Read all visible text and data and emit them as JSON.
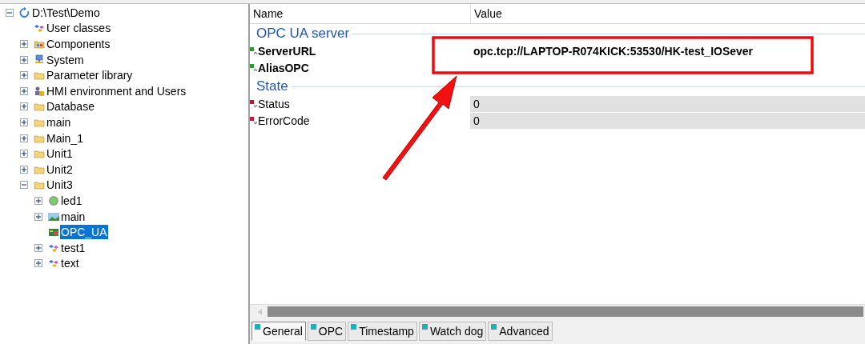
{
  "tree": [
    {
      "label": "D:\\Test\\Demo",
      "kind": "project",
      "expanded": true,
      "selected": false,
      "children": [
        {
          "label": "User classes",
          "kind": "classes",
          "selected": false
        },
        {
          "label": "Components",
          "kind": "components",
          "expanded": false,
          "selected": false
        },
        {
          "label": "System",
          "kind": "system",
          "expanded": false,
          "selected": false
        },
        {
          "label": "Parameter library",
          "kind": "folder",
          "expanded": false,
          "selected": false
        },
        {
          "label": "HMI environment and Users",
          "kind": "hmi",
          "expanded": false,
          "selected": false
        },
        {
          "label": "Database",
          "kind": "folder",
          "expanded": false,
          "selected": false
        },
        {
          "label": "main",
          "kind": "folder",
          "expanded": false,
          "selected": false
        },
        {
          "label": "Main_1",
          "kind": "folder",
          "expanded": false,
          "selected": false
        },
        {
          "label": "Unit1",
          "kind": "folder",
          "expanded": false,
          "selected": false
        },
        {
          "label": "Unit2",
          "kind": "folder",
          "expanded": false,
          "selected": false
        },
        {
          "label": "Unit3",
          "kind": "folder",
          "expanded": true,
          "selected": false,
          "children": [
            {
              "label": "led1",
              "kind": "led",
              "expanded": false,
              "selected": false
            },
            {
              "label": "main",
              "kind": "image",
              "expanded": false,
              "selected": false
            },
            {
              "label": "OPC_UA",
              "kind": "opc",
              "selected": true
            },
            {
              "label": "test1",
              "kind": "classes",
              "expanded": false,
              "selected": false
            },
            {
              "label": "text",
              "kind": "classes",
              "expanded": false,
              "selected": false
            }
          ]
        }
      ]
    }
  ],
  "properties": {
    "columns": [
      "Name",
      "Value"
    ],
    "rows": [
      {
        "kind": "section",
        "label": "OPC UA server"
      },
      {
        "kind": "property",
        "name": "ServerURL",
        "value": "opc.tcp://LAPTOP-R074KICK:53530/HK-test_IOSever",
        "readonly": false
      },
      {
        "kind": "property",
        "name": "AliasOPC",
        "readonly": false
      },
      {
        "kind": "section",
        "label": "State"
      },
      {
        "kind": "property",
        "name": "Status",
        "value": "0",
        "readonly": true
      },
      {
        "kind": "property",
        "name": "ErrorCode",
        "value": "0",
        "readonly": true
      }
    ]
  },
  "tabs": [
    {
      "label": "General",
      "selected": true
    },
    {
      "label": "OPC",
      "selected": false
    },
    {
      "label": "Timestamp",
      "selected": false
    },
    {
      "label": "Watch dog",
      "selected": false
    },
    {
      "label": "Advanced",
      "selected": false
    }
  ]
}
